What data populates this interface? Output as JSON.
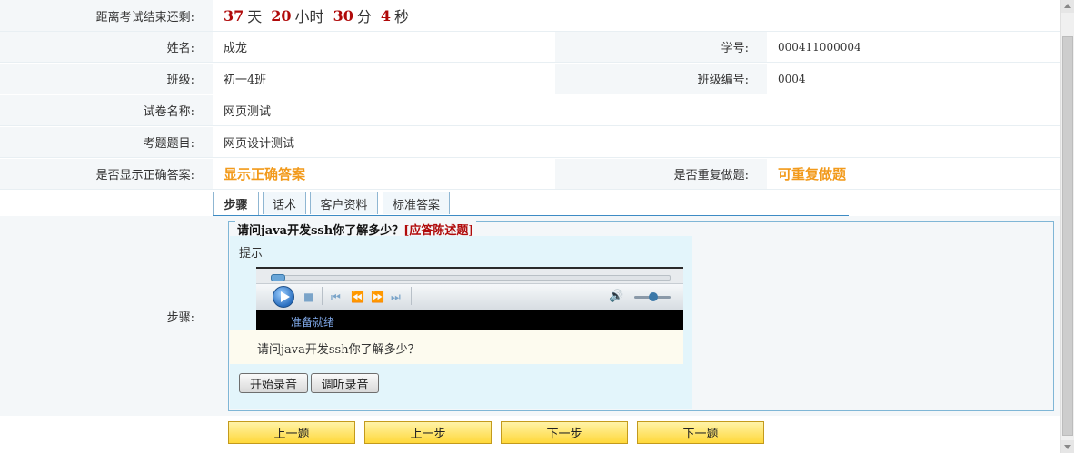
{
  "timer": {
    "label": "距离考试结束还剩:",
    "days": "37",
    "days_unit": "天",
    "hours": "20",
    "hours_unit": "小时",
    "minutes": "30",
    "minutes_unit": "分",
    "seconds": "4",
    "seconds_unit": "秒"
  },
  "info": {
    "name_label": "姓名:",
    "name_value": "成龙",
    "id_label": "学号:",
    "id_value": "000411000004",
    "class_label": "班级:",
    "class_value": "初一4班",
    "class_no_label": "班级编号:",
    "class_no_value": "0004",
    "paper_label": "试卷名称:",
    "paper_value": "网页测试",
    "topic_label": "考题题目:",
    "topic_value": "网页设计测试",
    "show_answer_label": "是否显示正确答案:",
    "show_answer_value": "显示正确答案",
    "repeat_label": "是否重复做题:",
    "repeat_value": "可重复做题"
  },
  "tabs": [
    {
      "label": "步骤"
    },
    {
      "label": "话术"
    },
    {
      "label": "客户资料"
    },
    {
      "label": "标准答案"
    }
  ],
  "step": {
    "label": "步骤:",
    "question_title": "请问java开发ssh你了解多少？",
    "question_tag": "[应答陈述题]",
    "hint_label": "提示",
    "player_status": "准备就绪",
    "question_text": "请问java开发ssh你了解多少？",
    "record_button": "开始录音",
    "listen_button": "调听录音"
  },
  "nav": {
    "prev_question": "上一题",
    "prev_step": "上一步",
    "next_step": "下一步",
    "next_question": "下一题"
  },
  "colors": {
    "accent_red": "#b00a0a",
    "accent_orange": "#f29a1b",
    "tab_border": "#3d8bc4",
    "nav_button": "#ffd83a"
  }
}
